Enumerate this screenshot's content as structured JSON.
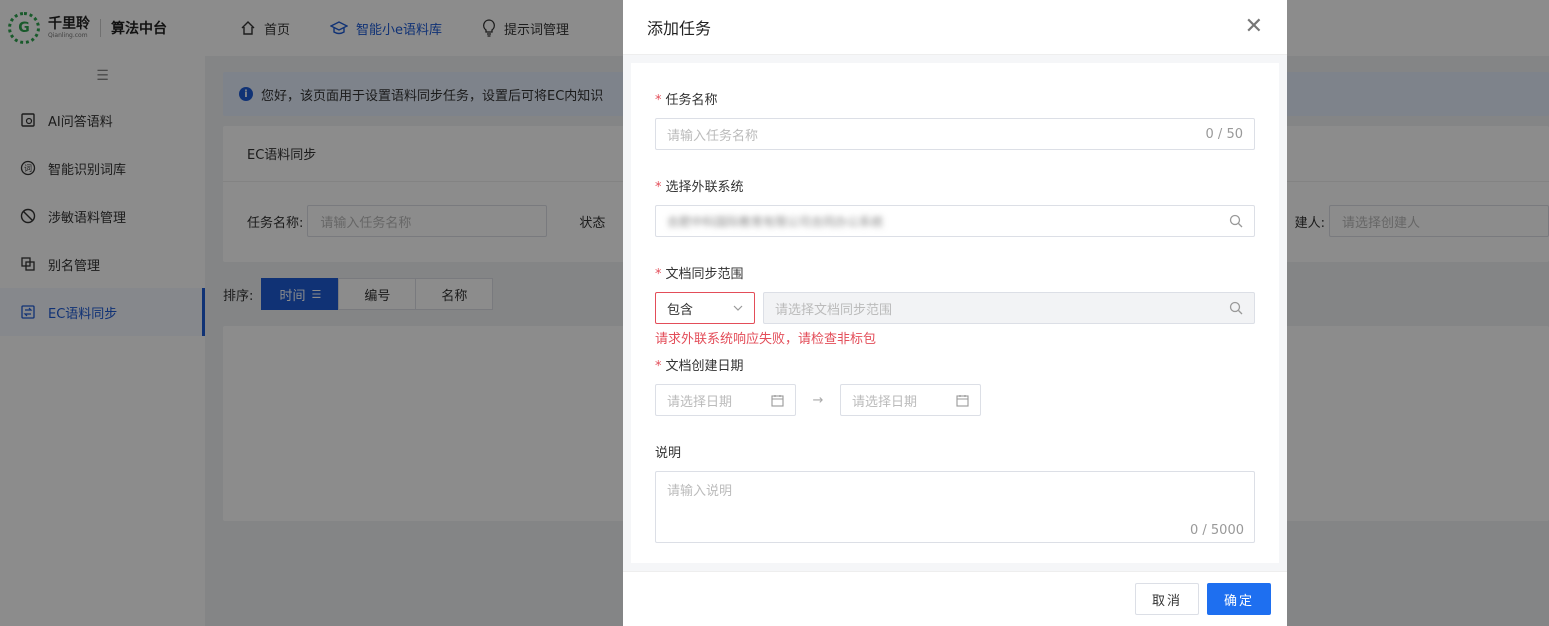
{
  "app": {
    "logo_cn": "千里聆",
    "logo_en": "Qianling.com",
    "app_name": "算法中台"
  },
  "topnav": {
    "items": [
      {
        "label": "首页",
        "icon": "home-icon"
      },
      {
        "label": "智能小e语料库",
        "icon": "graduation-cap-icon"
      },
      {
        "label": "提示词管理",
        "icon": "lightbulb-icon"
      }
    ]
  },
  "sidebar": {
    "items": [
      {
        "label": "AI问答语料",
        "icon": "qa-icon"
      },
      {
        "label": "智能识别词库",
        "icon": "dictionary-icon"
      },
      {
        "label": "涉敏语料管理",
        "icon": "ban-icon"
      },
      {
        "label": "别名管理",
        "icon": "alias-icon"
      },
      {
        "label": "EC语料同步",
        "icon": "sync-icon"
      }
    ]
  },
  "main": {
    "notice": "您好，该页面用于设置语料同步任务，设置后可将EC内知识",
    "panel_title": "EC语料同步",
    "filter": {
      "task_name_label": "任务名称:",
      "task_name_placeholder": "请输入任务名称",
      "status_label": "状态",
      "creator_label": "建人:",
      "creator_placeholder": "请选择创建人"
    },
    "sort": {
      "label": "排序:",
      "options": [
        "时间",
        "编号",
        "名称"
      ]
    }
  },
  "modal": {
    "title": "添加任务",
    "task_name": {
      "label": "任务名称",
      "placeholder": "请输入任务名称",
      "count": "0 / 50"
    },
    "external_system": {
      "label": "选择外联系统",
      "value": "合肥中科国际教育有限公司合同办公系统"
    },
    "doc_sync_range": {
      "label": "文档同步范围",
      "select_value": "包含",
      "placeholder": "请选择文档同步范围",
      "error": "请求外联系统响应失败，请检查非标包"
    },
    "doc_create_date": {
      "label": "文档创建日期",
      "start_placeholder": "请选择日期",
      "end_placeholder": "请选择日期",
      "separator": "→"
    },
    "description": {
      "label": "说明",
      "placeholder": "请输入说明",
      "count": "0 / 5000"
    },
    "footer": {
      "cancel": "取消",
      "confirm": "确定"
    }
  },
  "colors": {
    "primary": "#1e6ff0",
    "error": "#e34d59",
    "nav_active": "#1e5bd6"
  }
}
